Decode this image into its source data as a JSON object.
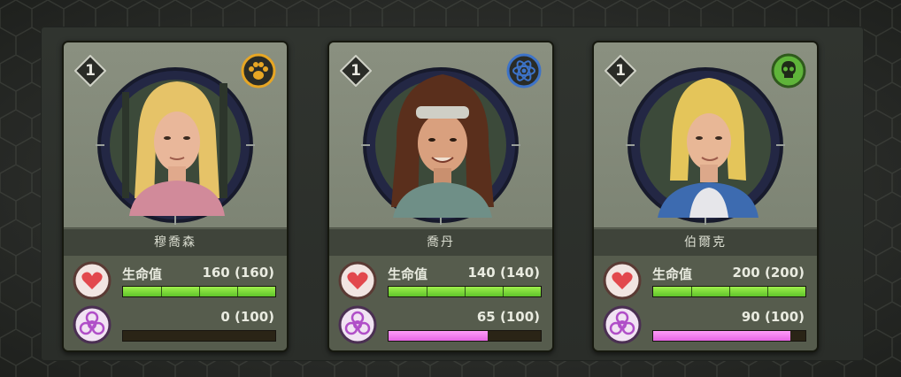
{
  "cards": [
    {
      "level": "1",
      "name": "穆喬森",
      "trait_icon": "paw-icon",
      "trait_color": "#e7a624",
      "hp_label": "生命值",
      "hp_text": "160 (160)",
      "hp_fraction": 1.0,
      "infection_text": "0 (100)",
      "infection_fraction": 0.0,
      "hair_color": "#e6c368",
      "shirt_color": "#d18a9a"
    },
    {
      "level": "1",
      "name": "喬丹",
      "trait_icon": "atom-icon",
      "trait_color": "#3d73c8",
      "hp_label": "生命值",
      "hp_text": "140 (140)",
      "hp_fraction": 1.0,
      "infection_text": "65 (100)",
      "infection_fraction": 0.65,
      "hair_color": "#5a2f1c",
      "shirt_color": "#6f8f87"
    },
    {
      "level": "1",
      "name": "伯爾克",
      "trait_icon": "skull-icon",
      "trait_color": "#5fb43a",
      "hp_label": "生命值",
      "hp_text": "200 (200)",
      "hp_fraction": 1.0,
      "infection_text": "90 (100)",
      "infection_fraction": 0.9,
      "hair_color": "#e4c55a",
      "shirt_color": "#3d6bb0"
    }
  ],
  "colors": {
    "hp_green": "#7ed93a",
    "infection_pink": "#f07cee",
    "heart_red": "#e2484d",
    "biohazard_purple": "#b04fc8"
  }
}
